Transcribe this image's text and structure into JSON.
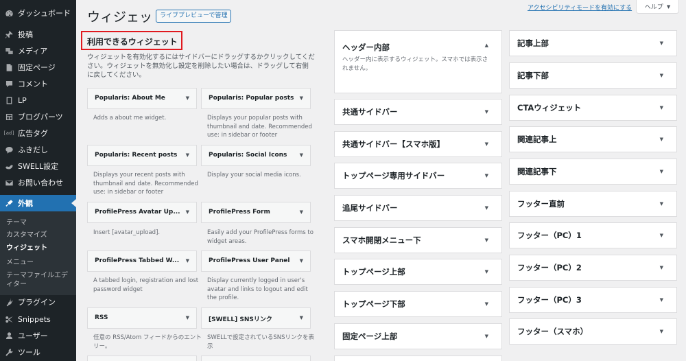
{
  "sidebar": {
    "items": [
      {
        "label": "ダッシュボード",
        "icon": "dashboard-icon"
      },
      {
        "label": "投稿",
        "icon": "pin-icon"
      },
      {
        "label": "メディア",
        "icon": "media-icon"
      },
      {
        "label": "固定ページ",
        "icon": "page-icon"
      },
      {
        "label": "コメント",
        "icon": "comment-icon"
      },
      {
        "label": "LP",
        "icon": "lp-icon"
      },
      {
        "label": "ブログパーツ",
        "icon": "blog-parts-icon"
      },
      {
        "label": "広告タグ",
        "icon": "ad-icon",
        "icon_text": "[ad]"
      },
      {
        "label": "ふきだし",
        "icon": "balloon-icon"
      },
      {
        "label": "SWELL設定",
        "icon": "swell-icon"
      },
      {
        "label": "お問い合わせ",
        "icon": "mail-icon"
      },
      {
        "label": "外観",
        "icon": "appearance-icon"
      },
      {
        "label": "プラグイン",
        "icon": "plugin-icon"
      },
      {
        "label": "Snippets",
        "icon": "scissors-icon"
      },
      {
        "label": "ユーザー",
        "icon": "user-icon"
      },
      {
        "label": "ツール",
        "icon": "wrench-icon"
      }
    ],
    "submenu": [
      "テーマ",
      "カスタマイズ",
      "ウィジェット",
      "メニュー",
      "テーマファイルエディター"
    ]
  },
  "header": {
    "title": "ウィジェット",
    "live_preview": "ライブプレビューで管理",
    "accessibility_link": "アクセシビリティモードを有効にする",
    "help": "ヘルプ"
  },
  "available": {
    "title": "利用できるウィジェット",
    "description": "ウィジェットを有効化するにはサイドバーにドラッグするかクリックしてください。ウィジェットを無効化し設定を削除したい場合は、ドラッグして右側に戻してください。",
    "widgets": [
      {
        "title": "Popularis: About Me",
        "desc": "Adds a about me widget."
      },
      {
        "title": "Popularis: Popular posts",
        "desc": "Displays your popular posts with thumbnail and date. Recommended use: in sidebar or footer"
      },
      {
        "title": "Popularis: Recent posts",
        "desc": "Displays your recent posts with thumbnail and date. Recommended use: in sidebar or footer"
      },
      {
        "title": "Popularis: Social Icons",
        "desc": "Display your social media icons."
      },
      {
        "title": "ProfilePress Avatar Up...",
        "desc": "Insert [avatar_upload]."
      },
      {
        "title": "ProfilePress Form",
        "desc": "Easily add your ProfilePress forms to widget areas."
      },
      {
        "title": "ProfilePress Tabbed W...",
        "desc": "A tabbed login, registration and lost password widget"
      },
      {
        "title": "ProfilePress User Panel",
        "desc": "Display currently logged in user's avatar and links to logout and edit the profile."
      },
      {
        "title": "RSS",
        "desc": "任意の RSS/Atom フィードからのエントリー。"
      },
      {
        "title": "[SWELL] SNSリンク",
        "desc": "SWELLで設定されているSNSリンクを表示"
      }
    ]
  },
  "areas_col1": [
    {
      "title": "ヘッダー内部",
      "desc": "ヘッダー内に表示するウィジェット。スマホでは表示されません。"
    },
    {
      "title": "共通サイドバー"
    },
    {
      "title": "共通サイドバー【スマホ版】"
    },
    {
      "title": "トップページ専用サイドバー"
    },
    {
      "title": "追尾サイドバー"
    },
    {
      "title": "スマホ開閉メニュー下"
    },
    {
      "title": "トップページ上部"
    },
    {
      "title": "トップページ下部"
    },
    {
      "title": "固定ページ上部"
    }
  ],
  "areas_col2": [
    {
      "title": "記事上部"
    },
    {
      "title": "記事下部"
    },
    {
      "title": "CTAウィジェット"
    },
    {
      "title": "関連記事上"
    },
    {
      "title": "関連記事下"
    },
    {
      "title": "フッター直前"
    },
    {
      "title": "フッター（PC）1"
    },
    {
      "title": "フッター（PC）2"
    },
    {
      "title": "フッター（PC）3"
    },
    {
      "title": "フッター（スマホ）"
    }
  ],
  "colors": {
    "admin_bar": "#1d2327",
    "accent": "#2271b1",
    "highlight_box": "#e0191f"
  }
}
